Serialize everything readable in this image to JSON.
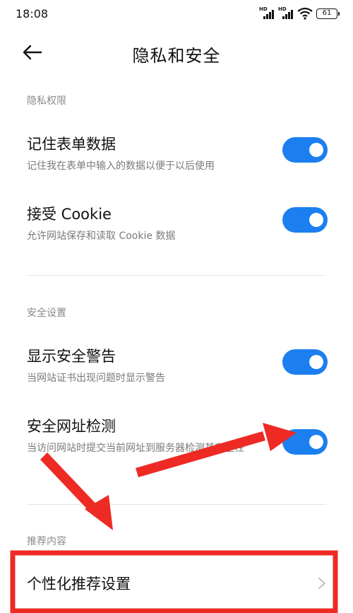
{
  "status_bar": {
    "time": "18:08",
    "signal_1_tag": "HD",
    "signal_2_tag": "HD",
    "battery": "61"
  },
  "header": {
    "title": "隐私和安全",
    "back_icon": "arrow-left-icon"
  },
  "sections": [
    {
      "header": "隐私权限",
      "items": [
        {
          "title": "记住表单数据",
          "subtitle": "记住我在表单中输入的数据以便于以后使用",
          "enabled": true
        },
        {
          "title": "接受 Cookie",
          "subtitle": "允许网站保存和读取 Cookie 数据",
          "enabled": true
        }
      ]
    },
    {
      "header": "安全设置",
      "items": [
        {
          "title": "显示安全警告",
          "subtitle": "当网站证书出现问题时显示警告",
          "enabled": true
        },
        {
          "title": "安全网址检测",
          "subtitle": "当访问网站时提交当前网址到服务器检测其安全性",
          "enabled": true
        }
      ]
    },
    {
      "header": "推荐内容",
      "items": [
        {
          "title": "个性化推荐设置",
          "chevron_icon": "chevron-right-icon"
        }
      ]
    }
  ],
  "colors": {
    "toggle_on": "#1b7ff0",
    "annotation": "#ee2a24",
    "section_header": "#8a8a8a"
  }
}
